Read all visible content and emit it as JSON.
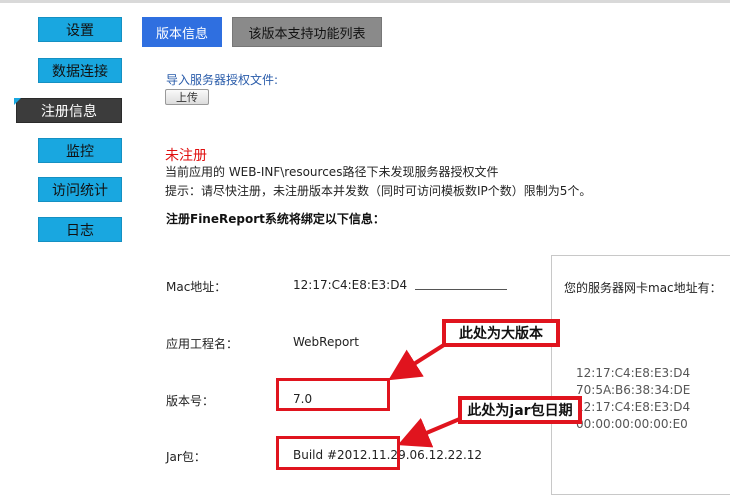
{
  "sidebar": {
    "items": [
      {
        "label": "设置"
      },
      {
        "label": "数据连接"
      },
      {
        "label": "注册信息"
      },
      {
        "label": "监控"
      },
      {
        "label": "访问统计"
      },
      {
        "label": "日志"
      }
    ],
    "active_index": 2
  },
  "tabs": [
    {
      "label": "版本信息",
      "selected": true
    },
    {
      "label": "该版本支持功能列表",
      "selected": false
    }
  ],
  "import": {
    "label": "导入服务器授权文件:",
    "upload_label": "上传"
  },
  "status": {
    "title": "未注册",
    "message": "当前应用的 WEB-INF\\resources路径下未发现服务器授权文件",
    "hint": "提示：请尽快注册，未注册版本并发数（同时可访问模板数IP个数）限制为5个。"
  },
  "binding_title": "注册FineReport系统将绑定以下信息：",
  "fields": {
    "mac": {
      "label": "Mac地址：",
      "value": "12:17:C4:E8:E3:D4"
    },
    "app": {
      "label": "应用工程名：",
      "value": "WebReport"
    },
    "version": {
      "label": "版本号：",
      "value": "7.0"
    },
    "jar": {
      "label": "Jar包：",
      "value": "Build #2012.11.29.06.12.22.12"
    }
  },
  "mac_panel": {
    "title": "您的服务器网卡mac地址有：",
    "addresses": [
      "12:17:C4:E8:E3:D4",
      "70:5A:B6:38:34:DE",
      "12:17:C4:E8:E3:D4",
      "00:00:00:00:00:E0"
    ]
  },
  "annotations": {
    "big_version": "此处为大版本",
    "jar_date": "此处为jar包日期"
  },
  "colors": {
    "sidebar": "#19a7e0",
    "sidebar_active": "#3c3c3c",
    "tab_selected": "#2f6fe0",
    "tab_normal": "#8a8a8a",
    "alert": "#e01010",
    "annotation": "#e0141e"
  }
}
